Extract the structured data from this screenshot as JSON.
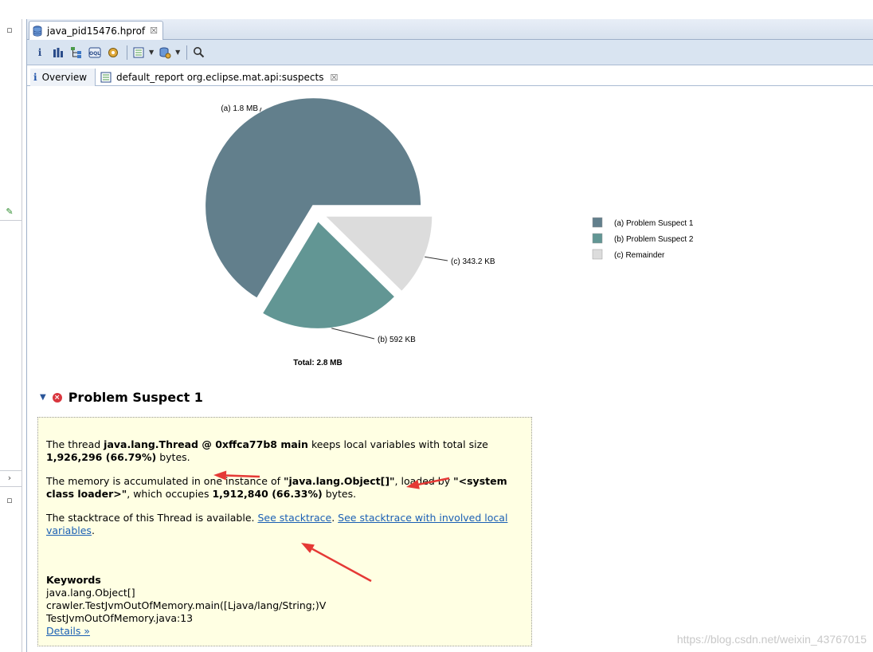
{
  "editor_tab": {
    "title": "java_pid15476.hprof",
    "close": "☒"
  },
  "subtabs": {
    "overview": {
      "icon": "i",
      "label": "Overview"
    },
    "report": {
      "label": "default_report  org.eclipse.mat.api:suspects",
      "close": "☒"
    }
  },
  "colors": {
    "suspect1": "#627f8c",
    "suspect2": "#629694",
    "remainder": "#dcdcdc",
    "arrow": "#e53935"
  },
  "chart_data": {
    "type": "pie",
    "slices": [
      {
        "key": "(a)",
        "name": "Problem Suspect 1",
        "value": 1.8,
        "label": "1.8 MB"
      },
      {
        "key": "(b)",
        "name": "Problem Suspect 2",
        "value": 0.5781,
        "label": "592 KB"
      },
      {
        "key": "(c)",
        "name": "Remainder",
        "value": 0.3352,
        "label": "343.2 KB"
      }
    ],
    "total_label": "Total: 2.8 MB",
    "legend_placement": "right"
  },
  "suspect": {
    "title": "Problem Suspect 1",
    "p1": {
      "t1": "The thread ",
      "b1": "java.lang.Thread @ 0xffca77b8 main",
      "t2": " keeps local variables with total size ",
      "b2": "1,926,296 (66.79%)",
      "t3": " bytes."
    },
    "p2": {
      "t1": "The memory is accumulated in one instance of ",
      "b1": "\"java.lang.Object[]\"",
      "t2": ", loaded by ",
      "b2": "\"<system class loader>\"",
      "t3": ", which occupies ",
      "b3": "1,912,840 (66.33%)",
      "t4": " bytes."
    },
    "p3": {
      "t1": "The stacktrace of this Thread is available. ",
      "link1": "See stacktrace",
      "t2": ". ",
      "link2": "See stacktrace with involved local variables",
      "t3": "."
    },
    "keywords_label": "Keywords",
    "keywords": [
      "java.lang.Object[]",
      "crawler.TestJvmOutOfMemory.main([Ljava/lang/String;)V",
      "TestJvmOutOfMemory.java:13"
    ],
    "details_link": "Details »"
  },
  "watermark": "https://blog.csdn.net/weixin_43767015"
}
